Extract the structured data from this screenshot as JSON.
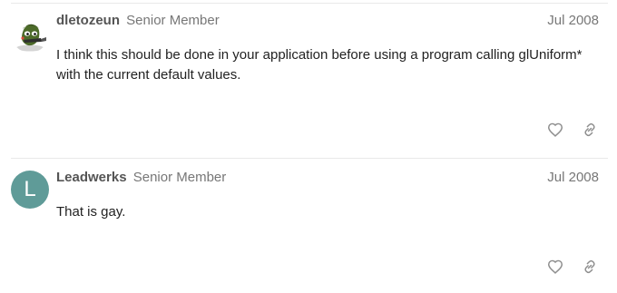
{
  "posts": [
    {
      "username": "dletozeun",
      "user_title": "Senior Member",
      "date": "Jul 2008",
      "body": "I think this should be done in your application before using a program calling glUniform* with the current default values.",
      "avatar_type": "image"
    },
    {
      "username": "Leadwerks",
      "user_title": "Senior Member",
      "date": "Jul 2008",
      "body": "That is gay.",
      "avatar_type": "letter",
      "avatar_letter": "L",
      "avatar_color": "#5f9b98"
    }
  ],
  "icons": {
    "like": "heart-icon",
    "share": "link-icon"
  }
}
